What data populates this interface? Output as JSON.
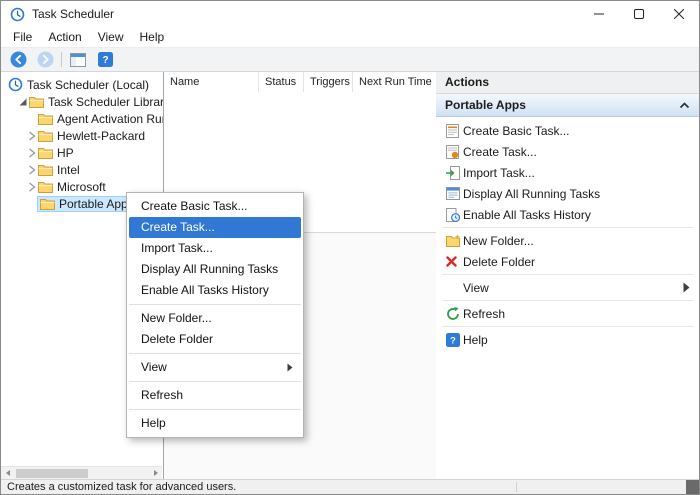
{
  "window": {
    "title": "Task Scheduler"
  },
  "menu_bar": {
    "items": [
      "File",
      "Action",
      "View",
      "Help"
    ]
  },
  "toolbar": {
    "icons": [
      "back-icon",
      "forward-icon",
      "show-console-tree-icon",
      "help-icon"
    ]
  },
  "tree": {
    "root_label": "Task Scheduler (Local)",
    "library_label": "Task Scheduler Library",
    "folders": [
      {
        "label": "Agent Activation Runt",
        "expandable": false,
        "selected": false
      },
      {
        "label": "Hewlett-Packard",
        "expandable": true,
        "selected": false
      },
      {
        "label": "HP",
        "expandable": true,
        "selected": false
      },
      {
        "label": "Intel",
        "expandable": true,
        "selected": false
      },
      {
        "label": "Microsoft",
        "expandable": true,
        "selected": false
      },
      {
        "label": "Portable Apps",
        "expandable": false,
        "selected": true
      }
    ]
  },
  "task_list": {
    "columns": [
      "Name",
      "Status",
      "Triggers",
      "Next Run Time"
    ]
  },
  "context_menu": {
    "items": [
      "Create Basic Task...",
      "Create Task...",
      "Import Task...",
      "Display All Running Tasks",
      "Enable All Tasks History",
      "New Folder...",
      "Delete Folder",
      "View",
      "Refresh",
      "Help"
    ],
    "highlighted_item": "Create Task..."
  },
  "actions_panel": {
    "title": "Actions",
    "section_label": "Portable Apps",
    "items": [
      {
        "label": "Create Basic Task...",
        "icon": "create-basic-task-icon"
      },
      {
        "label": "Create Task...",
        "icon": "create-task-icon"
      },
      {
        "label": "Import Task...",
        "icon": "import-task-icon"
      },
      {
        "label": "Display All Running Tasks",
        "icon": "display-running-tasks-icon"
      },
      {
        "label": "Enable All Tasks History",
        "icon": "tasks-history-icon"
      },
      {
        "label": "New Folder...",
        "icon": "new-folder-icon"
      },
      {
        "label": "Delete Folder",
        "icon": "delete-folder-icon"
      },
      {
        "label": "View",
        "icon": "submenu-arrow-icon"
      },
      {
        "label": "Refresh",
        "icon": "refresh-icon"
      },
      {
        "label": "Help",
        "icon": "help-icon"
      }
    ]
  },
  "status_bar": {
    "text": "Creates a customized task for advanced users."
  },
  "colors": {
    "accent_blue": "#2f7bd8",
    "menu_highlight": "#3178d4",
    "selection_bg": "#cce8ff",
    "selection_border": "#99d1ff",
    "delete_red": "#d42b2b",
    "refresh_green": "#2e9e44",
    "folder_yellow": "#fbd56e"
  }
}
